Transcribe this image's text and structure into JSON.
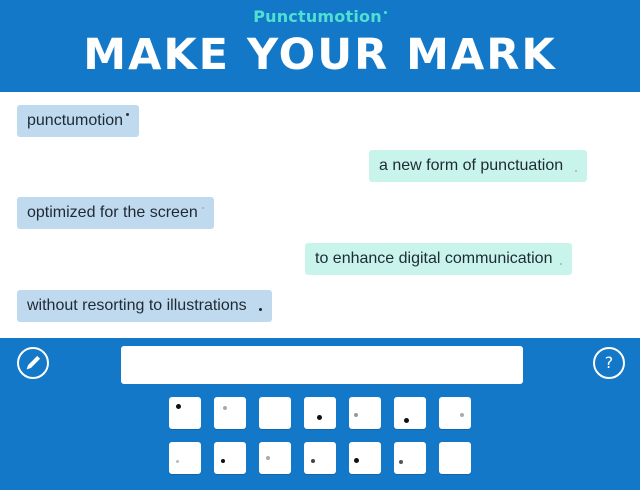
{
  "header": {
    "brand": "Punctumotion",
    "headline": "MAKE YOUR MARK"
  },
  "messages": [
    {
      "side": "left",
      "text": "punctumotion",
      "mark_color": "#333333"
    },
    {
      "side": "right",
      "text": "a new form of punctuation",
      "mark_color": "#9fb8b4"
    },
    {
      "side": "left",
      "text": "optimized for the screen",
      "mark_color": "#9fb0c0"
    },
    {
      "side": "right",
      "text": "to enhance digital communication",
      "mark_color": "#9fb8b4"
    },
    {
      "side": "left",
      "text": "without resorting to illustrations",
      "mark_color": "#222222"
    }
  ],
  "composer": {
    "input_value": "",
    "pencil_icon": "pencil-icon",
    "help_label": "?"
  },
  "keyboard": {
    "row1": [
      "mark-1",
      "mark-2",
      "mark-3",
      "mark-4",
      "mark-5",
      "mark-6",
      "mark-7"
    ],
    "row2": [
      "mark-8",
      "mark-9",
      "mark-10",
      "mark-11",
      "mark-12",
      "mark-13",
      "mark-14"
    ]
  },
  "colors": {
    "brand_blue": "#1478c8",
    "brand_teal": "#4fe0d2",
    "bubble_left": "#bfd9ef",
    "bubble_right": "#c8f4ec"
  }
}
